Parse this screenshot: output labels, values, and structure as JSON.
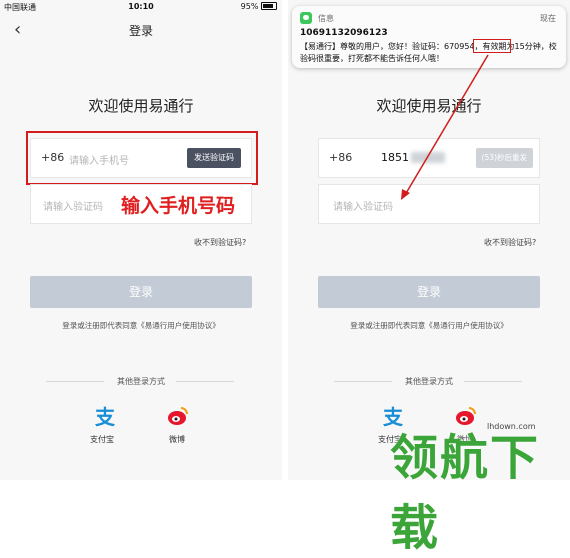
{
  "left_phone": {
    "status": {
      "carrier": "中国联通",
      "time": "10:10",
      "battery": "95%"
    },
    "nav": {
      "title": "登录"
    },
    "welcome": "欢迎使用易通行",
    "phone_field": {
      "prefix": "+86",
      "placeholder": "请输入手机号",
      "send_button": "发送验证码"
    },
    "code_field": {
      "placeholder": "请输入验证码"
    },
    "annotation": "输入手机号码",
    "no_code_link": "收不到验证码?",
    "login_button": "登录",
    "agreement": "登录或注册即代表同意《易通行用户使用协议》",
    "other_login": {
      "title": "其他登录方式",
      "alipay": "支付宝",
      "weibo": "微博"
    }
  },
  "right_phone": {
    "notification": {
      "app": "信息",
      "time": "现在",
      "sender": "10691132096123",
      "body": "【易通行】尊敬的用户，您好！验证码：670954，有效期为15分钟，校验码很重要，打死都不能告诉任何人哦！",
      "code": "670954"
    },
    "welcome": "欢迎使用易通行",
    "phone_field": {
      "prefix": "+86",
      "value": "1851",
      "resend_button": "(53)秒后重发"
    },
    "code_field": {
      "placeholder": "请输入验证码"
    },
    "no_code_link": "收不到验证码?",
    "login_button": "登录",
    "agreement": "登录或注册即代表同意《易通行用户使用协议》",
    "other_login": {
      "title": "其他登录方式",
      "alipay": "支付宝",
      "weibo": "微博"
    }
  },
  "watermark": {
    "text": "领航下载",
    "url": "lhdown.com"
  },
  "colors": {
    "annotation_red": "#d31c1c",
    "login_disabled": "#c3ccd6",
    "send_button": "#4a5262",
    "watermark_green": "#3ca53a"
  }
}
